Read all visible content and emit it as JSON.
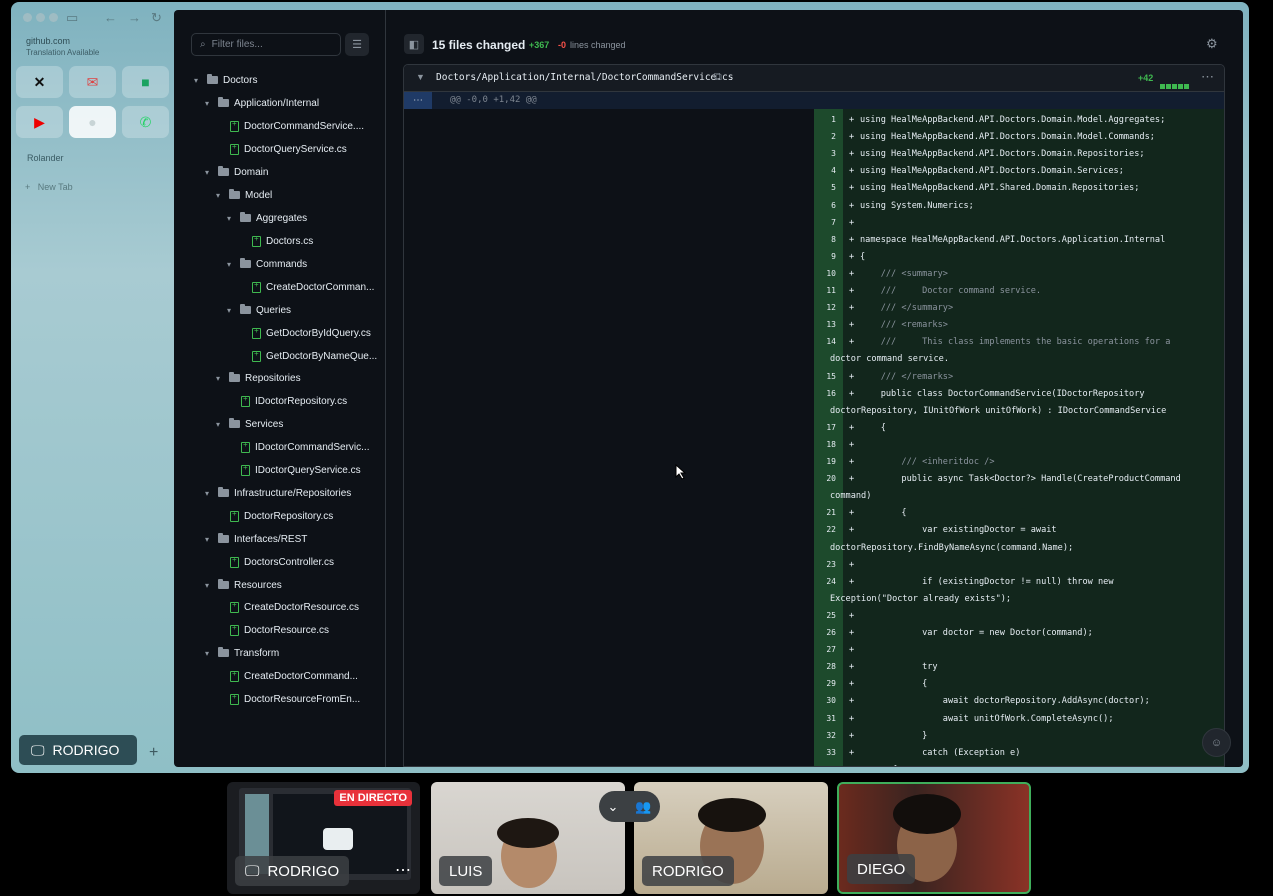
{
  "browser": {
    "url": "github.com",
    "translation": "Translation Available",
    "favorites": [
      "X",
      "Gmail",
      "Chat",
      "YouTube",
      "GitHub",
      "WhatsApp"
    ],
    "folder": "Rolander",
    "new_tab": "New Tab"
  },
  "presenter": {
    "name": "RODRIGO"
  },
  "tree": {
    "filter_placeholder": "Filter files...",
    "nodes": [
      {
        "label": "Doctors",
        "type": "folder"
      },
      {
        "label": "Application/Internal",
        "type": "folder"
      },
      {
        "label": "DoctorCommandService....",
        "type": "file"
      },
      {
        "label": "DoctorQueryService.cs",
        "type": "file"
      },
      {
        "label": "Domain",
        "type": "folder"
      },
      {
        "label": "Model",
        "type": "folder"
      },
      {
        "label": "Aggregates",
        "type": "folder"
      },
      {
        "label": "Doctors.cs",
        "type": "file"
      },
      {
        "label": "Commands",
        "type": "folder"
      },
      {
        "label": "CreateDoctorComman...",
        "type": "file"
      },
      {
        "label": "Queries",
        "type": "folder"
      },
      {
        "label": "GetDoctorByIdQuery.cs",
        "type": "file"
      },
      {
        "label": "GetDoctorByNameQue...",
        "type": "file"
      },
      {
        "label": "Repositories",
        "type": "folder"
      },
      {
        "label": "IDoctorRepository.cs",
        "type": "file"
      },
      {
        "label": "Services",
        "type": "folder"
      },
      {
        "label": "IDoctorCommandServic...",
        "type": "file"
      },
      {
        "label": "IDoctorQueryService.cs",
        "type": "file"
      },
      {
        "label": "Infrastructure/Repositories",
        "type": "folder"
      },
      {
        "label": "DoctorRepository.cs",
        "type": "file"
      },
      {
        "label": "Interfaces/REST",
        "type": "folder"
      },
      {
        "label": "DoctorsController.cs",
        "type": "file"
      },
      {
        "label": "Resources",
        "type": "folder"
      },
      {
        "label": "CreateDoctorResource.cs",
        "type": "file"
      },
      {
        "label": "DoctorResource.cs",
        "type": "file"
      },
      {
        "label": "Transform",
        "type": "folder"
      },
      {
        "label": "CreateDoctorCommand...",
        "type": "file"
      },
      {
        "label": "DoctorResourceFromEn...",
        "type": "file"
      }
    ]
  },
  "diff": {
    "files_changed": "15 files changed",
    "additions": "+367",
    "deletions": "-0",
    "lines_changed": "lines changed",
    "file_path": "Doctors/Application/Internal/DoctorCommandService.cs",
    "file_additions": "+42",
    "hunk": "@@ -0,0 +1,42 @@",
    "lines": [
      {
        "n": "1",
        "t": "using HealMeAppBackend.API.Doctors.Domain.Model.Aggregates;"
      },
      {
        "n": "2",
        "t": "using HealMeAppBackend.API.Doctors.Domain.Model.Commands;"
      },
      {
        "n": "3",
        "t": "using HealMeAppBackend.API.Doctors.Domain.Repositories;"
      },
      {
        "n": "4",
        "t": "using HealMeAppBackend.API.Doctors.Domain.Services;"
      },
      {
        "n": "5",
        "t": "using HealMeAppBackend.API.Shared.Domain.Repositories;"
      },
      {
        "n": "6",
        "t": "using System.Numerics;"
      },
      {
        "n": "7",
        "t": ""
      },
      {
        "n": "8",
        "t": "namespace HealMeAppBackend.API.Doctors.Application.Internal"
      },
      {
        "n": "9",
        "t": "{"
      },
      {
        "n": "10",
        "t": "    /// <summary>"
      },
      {
        "n": "11",
        "t": "    ///     Doctor command service."
      },
      {
        "n": "12",
        "t": "    /// </summary>"
      },
      {
        "n": "13",
        "t": "    /// <remarks>"
      },
      {
        "n": "14",
        "t": "    ///     This class implements the basic operations for a"
      },
      {
        "n": "",
        "t": "doctor command service."
      },
      {
        "n": "15",
        "t": "    /// </remarks>"
      },
      {
        "n": "16",
        "t": "    public class DoctorCommandService(IDoctorRepository"
      },
      {
        "n": "",
        "t": "doctorRepository, IUnitOfWork unitOfWork) : IDoctorCommandService"
      },
      {
        "n": "17",
        "t": "    {"
      },
      {
        "n": "18",
        "t": ""
      },
      {
        "n": "19",
        "t": "        /// <inheritdoc />"
      },
      {
        "n": "20",
        "t": "        public async Task<Doctor?> Handle(CreateProductCommand"
      },
      {
        "n": "",
        "t": "command)"
      },
      {
        "n": "21",
        "t": "        {"
      },
      {
        "n": "22",
        "t": "            var existingDoctor = await"
      },
      {
        "n": "",
        "t": "doctorRepository.FindByNameAsync(command.Name);"
      },
      {
        "n": "23",
        "t": ""
      },
      {
        "n": "24",
        "t": "            if (existingDoctor != null) throw new"
      },
      {
        "n": "",
        "t": "Exception(\"Doctor already exists\");"
      },
      {
        "n": "25",
        "t": ""
      },
      {
        "n": "26",
        "t": "            var doctor = new Doctor(command);"
      },
      {
        "n": "27",
        "t": ""
      },
      {
        "n": "28",
        "t": "            try"
      },
      {
        "n": "29",
        "t": "            {"
      },
      {
        "n": "30",
        "t": "                await doctorRepository.AddAsync(doctor);"
      },
      {
        "n": "31",
        "t": "                await unitOfWork.CompleteAsync();"
      },
      {
        "n": "32",
        "t": "            }"
      },
      {
        "n": "33",
        "t": "            catch (Exception e)"
      },
      {
        "n": "",
        "t": "            {"
      }
    ]
  },
  "meeting": {
    "live_label": "EN DIRECTO",
    "participants": [
      "RODRIGO",
      "LUIS",
      "RODRIGO",
      "DIEGO"
    ]
  }
}
